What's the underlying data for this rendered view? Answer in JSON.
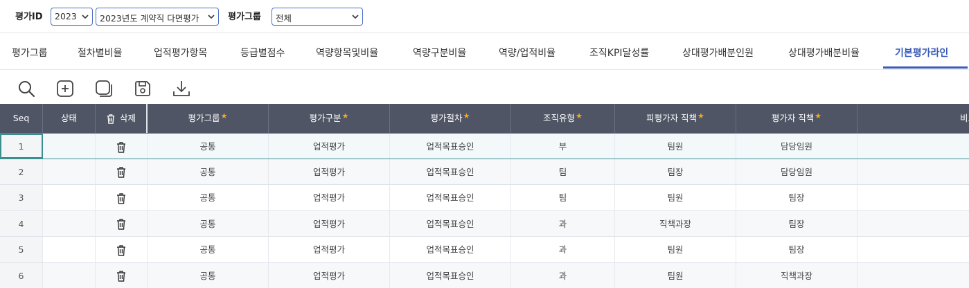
{
  "filters": {
    "eval_id_label": "평가ID",
    "year_value": "2023",
    "eval_name_value": "2023년도 계약직 다면평가",
    "group_label": "평가그룹",
    "group_value": "전체"
  },
  "tabs": [
    {
      "label": "평가그룹"
    },
    {
      "label": "절차별비율"
    },
    {
      "label": "업적평가항목"
    },
    {
      "label": "등급별점수"
    },
    {
      "label": "역량항목및비율"
    },
    {
      "label": "역량구분비율"
    },
    {
      "label": "역량/업적비율"
    },
    {
      "label": "조직KPI달성률"
    },
    {
      "label": "상대평가배분인원"
    },
    {
      "label": "상대평가배분비율"
    },
    {
      "label": "기본평가라인"
    }
  ],
  "toolbar": {
    "icons": [
      "search-icon",
      "add-icon",
      "copy-icon",
      "save-icon",
      "download-icon"
    ]
  },
  "grid": {
    "columns": {
      "seq": "Seq",
      "status": "상태",
      "delete": "삭제",
      "group": "평가그룹",
      "category": "평가구분",
      "procedure": "평가절차",
      "org_type": "조직유형",
      "evaluatee_position": "피평가자 직책",
      "evaluator_position": "평가자 직책",
      "note": "비고"
    },
    "rows": [
      {
        "seq": "1",
        "status": "",
        "group": "공통",
        "category": "업적평가",
        "procedure": "업적목표승인",
        "org_type": "부",
        "evaluatee_position": "팀원",
        "evaluator_position": "담당임원",
        "note": ""
      },
      {
        "seq": "2",
        "status": "",
        "group": "공통",
        "category": "업적평가",
        "procedure": "업적목표승인",
        "org_type": "팀",
        "evaluatee_position": "팀장",
        "evaluator_position": "담당임원",
        "note": ""
      },
      {
        "seq": "3",
        "status": "",
        "group": "공통",
        "category": "업적평가",
        "procedure": "업적목표승인",
        "org_type": "팀",
        "evaluatee_position": "팀원",
        "evaluator_position": "팀장",
        "note": ""
      },
      {
        "seq": "4",
        "status": "",
        "group": "공통",
        "category": "업적평가",
        "procedure": "업적목표승인",
        "org_type": "과",
        "evaluatee_position": "직책과장",
        "evaluator_position": "팀장",
        "note": ""
      },
      {
        "seq": "5",
        "status": "",
        "group": "공통",
        "category": "업적평가",
        "procedure": "업적목표승인",
        "org_type": "과",
        "evaluatee_position": "팀원",
        "evaluator_position": "팀장",
        "note": ""
      },
      {
        "seq": "6",
        "status": "",
        "group": "공통",
        "category": "업적평가",
        "procedure": "업적목표승인",
        "org_type": "과",
        "evaluatee_position": "팀원",
        "evaluator_position": "직책과장",
        "note": ""
      }
    ]
  },
  "colors": {
    "accent": "#3a5cb8",
    "header_bg": "#4f5564",
    "required_star": "#f5a623",
    "selection": "#3c8f8f"
  }
}
